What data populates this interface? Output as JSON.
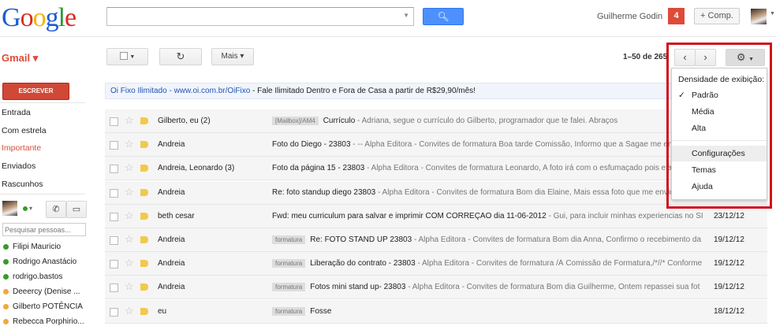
{
  "header": {
    "logo": "Google",
    "search_value": "",
    "user_name": "Guilherme Godin",
    "notifications": "4",
    "share_label": "+ Comp."
  },
  "toolbar": {
    "app_label": "Gmail ▾",
    "more_label": "Mais ▾",
    "refresh_icon": "refresh-icon",
    "count": "1–50 de 265"
  },
  "sidebar": {
    "compose": "ESCREVER",
    "items": [
      {
        "label": "Entrada"
      },
      {
        "label": "Com estrela"
      },
      {
        "label": "Importante"
      },
      {
        "label": "Enviados"
      },
      {
        "label": "Rascunhos"
      }
    ],
    "chat_search_placeholder": "Pesquisar pessoas...",
    "contacts": [
      {
        "name": "Filipi Mauricio",
        "status": "#3a9a2a"
      },
      {
        "name": "Rodrigo Anastácio",
        "status": "#3a9a2a"
      },
      {
        "name": "rodrigo.bastos",
        "status": "#3a9a2a"
      },
      {
        "name": "Deeercy (Denise ...",
        "status": "#f0a93c"
      },
      {
        "name": "Gilberto POTÊNCIA",
        "status": "#f0a93c"
      },
      {
        "name": "Rebecca Porphirio...",
        "status": "#f0a93c"
      }
    ]
  },
  "ad": {
    "link": "Oi Fixo Ilimitado - www.oi.com.br/OiFixo",
    "text": " - Fale Ilimitado Dentro e Fora de Casa a partir de R$29,90/mês!"
  },
  "emails": [
    {
      "sender": "Gilberto, eu (2)",
      "label": "[Mailbox]/AM4",
      "subject": "Currículo",
      "snippet": " - Adriana, segue o currículo do Gilberto, programador que te falei. Abraços",
      "date": ""
    },
    {
      "sender": "Andreia",
      "label": "",
      "subject": "Foto do Diego - 23803",
      "snippet": " - -- Alpha Editora - Convites de formatura Boa tarde Comissão, Informo que a Sagae me enviou",
      "date": ""
    },
    {
      "sender": "Andreia, Leonardo (3)",
      "label": "",
      "subject": "Foto da página 15 - 23803",
      "snippet": " - Alpha Editora - Convites de formatura Leonardo, A foto irá com o esfumaçado pois ela v",
      "date": ""
    },
    {
      "sender": "Andreia",
      "label": "",
      "subject": "Re: foto standup diego 23803",
      "snippet": " - Alpha Editora - Convites de formatura Bom dia Elaine, Mais essa foto que me enviou",
      "date": ""
    },
    {
      "sender": "beth cesar",
      "label": "",
      "subject": "Fwd: meu curriculum para salvar e imprimir COM CORREÇÃO dia 11-06-2012",
      "snippet": " - Gui, para incluir minhas experiencias no SI",
      "date": "23/12/12"
    },
    {
      "sender": "Andreia",
      "label": "formatura",
      "subject": "Re: FOTO STAND UP 23803",
      "snippet": " - Alpha Editora - Convites de formatura Bom dia Anna, Confirmo o recebimento da",
      "date": "19/12/12"
    },
    {
      "sender": "Andreia",
      "label": "formatura",
      "subject": "Liberação do contrato - 23803",
      "snippet": " - Alpha Editora - Convites de formatura /À Comissão de Formatura,/*//* Conforme",
      "date": "19/12/12"
    },
    {
      "sender": "Andreia",
      "label": "formatura",
      "subject": "Fotos mini stand up- 23803",
      "snippet": " - Alpha Editora - Convites de formatura Bom dia Guilherme, Ontem repassei sua fot",
      "date": "19/12/12"
    },
    {
      "sender": "eu",
      "label": "formatura",
      "subject": "Fosse",
      "snippet": "",
      "date": "18/12/12"
    }
  ],
  "settings_menu": {
    "heading": "Densidade de exibição:",
    "check": "✓",
    "items": [
      "Padrão",
      "Média",
      "Alta",
      "Configurações",
      "Temas",
      "Ajuda"
    ]
  },
  "colors": {
    "accent": "#dd4b39",
    "highlight": "#d0121b",
    "search_blue": "#4d90fe"
  }
}
